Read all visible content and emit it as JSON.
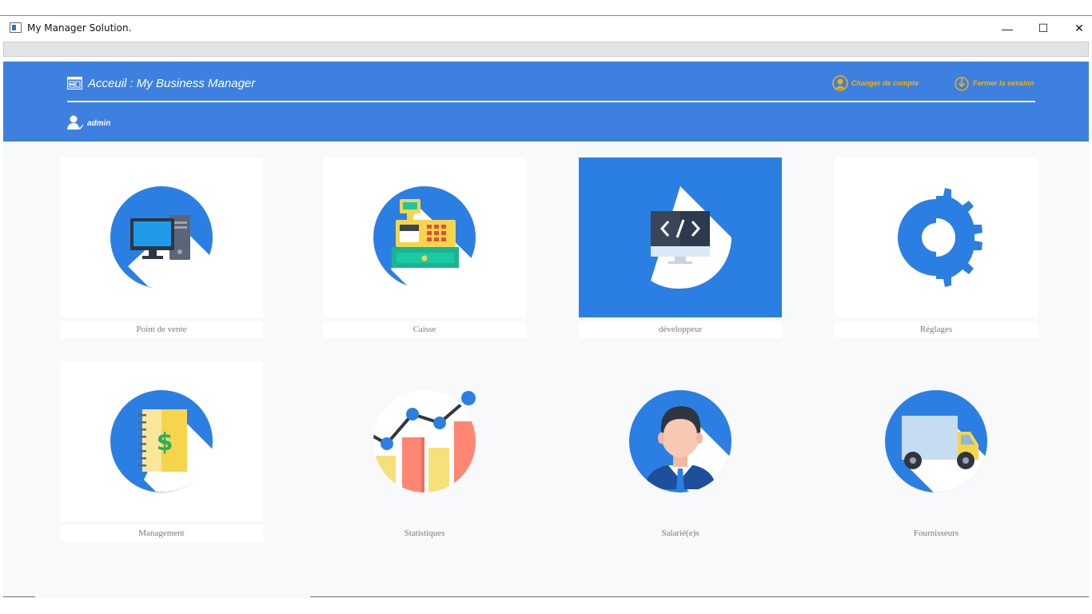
{
  "window": {
    "title": "My Manager Solution.",
    "controls": {
      "minimize": "—",
      "maximize": "☐",
      "close": "✕"
    }
  },
  "header": {
    "breadcrumb": "Acceuil : My Business Manager",
    "user": "admin",
    "actions": {
      "change_account": "Changer de compte",
      "logout": "Fermer la session"
    },
    "colors": {
      "bar": "#3d80e0",
      "action": "#f6b000"
    }
  },
  "tiles": [
    {
      "label": "Point de vente",
      "icon": "computer-icon"
    },
    {
      "label": "Caisse",
      "icon": "cash-register-icon"
    },
    {
      "label": "développeur",
      "icon": "code-monitor-icon",
      "selected": true
    },
    {
      "label": "Réglages",
      "icon": "gear-icon"
    },
    {
      "label": "Management",
      "icon": "dollar-notebook-icon"
    },
    {
      "label": "Statistiques",
      "icon": "statistics-chart-icon"
    },
    {
      "label": "Salarié(e)s",
      "icon": "employee-icon"
    },
    {
      "label": "Fournisseurs",
      "icon": "delivery-truck-icon"
    }
  ]
}
